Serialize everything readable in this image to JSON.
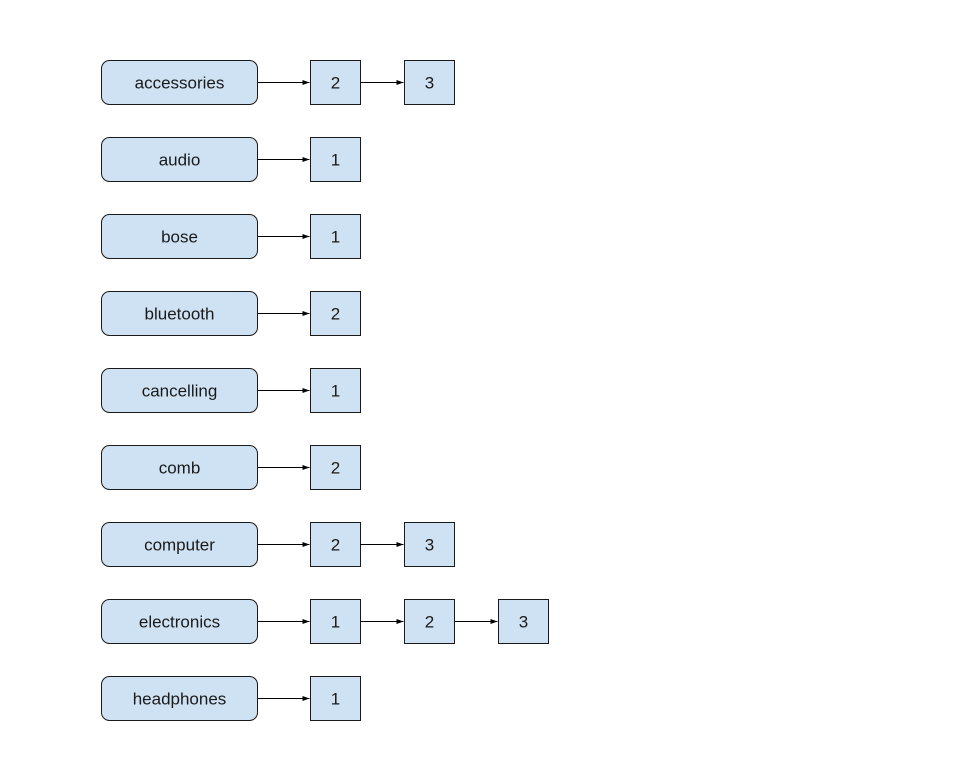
{
  "diagram": {
    "type": "inverted-index-posting-lists",
    "colors": {
      "node_fill": "#cfe2f3",
      "node_stroke": "#1a1a1a",
      "edge": "#000000"
    },
    "rows": [
      {
        "term": "accessories",
        "postings": [
          "2",
          "3"
        ]
      },
      {
        "term": "audio",
        "postings": [
          "1"
        ]
      },
      {
        "term": "bose",
        "postings": [
          "1"
        ]
      },
      {
        "term": "bluetooth",
        "postings": [
          "2"
        ]
      },
      {
        "term": "cancelling",
        "postings": [
          "1"
        ]
      },
      {
        "term": "comb",
        "postings": [
          "2"
        ]
      },
      {
        "term": "computer",
        "postings": [
          "2",
          "3"
        ]
      },
      {
        "term": "electronics",
        "postings": [
          "1",
          "2",
          "3"
        ]
      },
      {
        "term": "headphones",
        "postings": [
          "1"
        ]
      }
    ]
  }
}
